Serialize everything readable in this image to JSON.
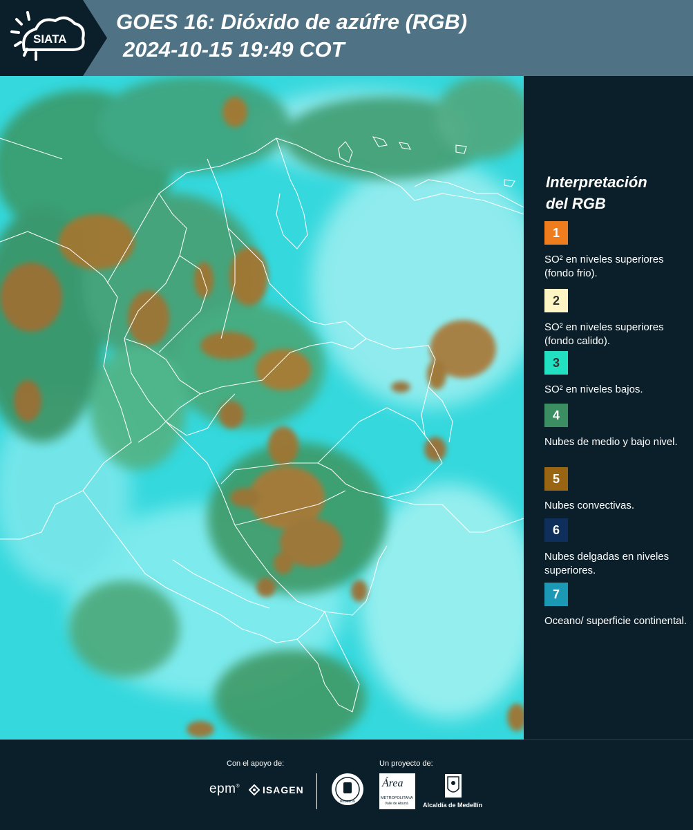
{
  "header": {
    "logo_text": "SIATA",
    "title_line1": "GOES 16: Dióxido de azúfre (RGB)",
    "title_line2": "2024-10-15 19:49 COT"
  },
  "legend": {
    "title_line1": "Interpretación",
    "title_line2": "del RGB",
    "items": [
      {
        "number": "1",
        "color": "#f07d1d",
        "number_color": "#ffffff",
        "label": "SO² en niveles superiores (fondo frio)."
      },
      {
        "number": "2",
        "color": "#fdf5c4",
        "number_color": "#333333",
        "label": "SO² en niveles superiores (fondo calido)."
      },
      {
        "number": "3",
        "color": "#22e0c2",
        "number_color": "#333333",
        "label": "SO² en niveles bajos."
      },
      {
        "number": "4",
        "color": "#3a8e62",
        "number_color": "#ffffff",
        "label": "Nubes de medio y bajo nivel."
      },
      {
        "number": "5",
        "color": "#9a6512",
        "number_color": "#ffffff",
        "label": "Nubes convectivas."
      },
      {
        "number": "6",
        "color": "#0e2f5c",
        "number_color": "#ffffff",
        "label": "Nubes delgadas en niveles superiores."
      },
      {
        "number": "7",
        "color": "#1a98b4",
        "number_color": "#ffffff",
        "label": "Oceano/ superficie continental."
      }
    ]
  },
  "footer": {
    "support_caption": "Con el apoyo de:",
    "project_caption": "Un proyecto de:",
    "epm": "epm",
    "isagen": "ISAGEN",
    "metropolitana": "METROPOLITANA",
    "valle": "Valle de Aburrá",
    "area": "Área",
    "medellin": "MEDELLÍN",
    "alcaldia": "Alcaldía de Medellín"
  }
}
